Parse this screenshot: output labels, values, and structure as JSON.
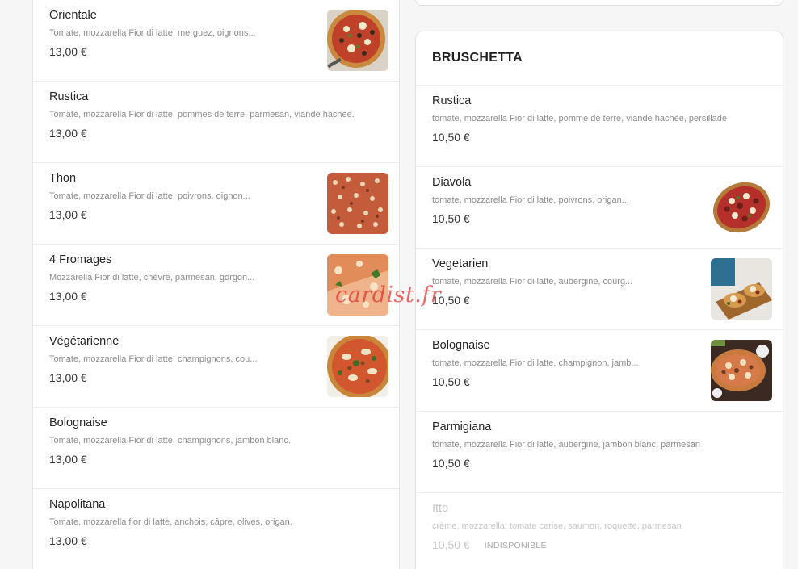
{
  "left_items": [
    {
      "name": "Orientale",
      "desc": "Tomate, mozzarella Fior di latte, merguez, oignons...",
      "price": "13,00 €",
      "image": "pizza-orientale"
    },
    {
      "name": "Rustica",
      "desc": "Tomate, mozzarella Fior di latte, pommes de terre, parmesan, viande hachée.",
      "price": "13,00 €",
      "image": ""
    },
    {
      "name": "Thon",
      "desc": "Tomate, mozzarella Fior di latte, poivrons, oignon...",
      "price": "13,00 €",
      "image": "pizza-thon"
    },
    {
      "name": "4 Fromages",
      "desc": "Mozzarella Fior di latte, chèvre, parmesan, gorgon...",
      "price": "13,00 €",
      "image": "pizza-4-fromages"
    },
    {
      "name": "Végétarienne",
      "desc": "Tomate, mozzarella Fior di latte, champignons, cou...",
      "price": "13,00 €",
      "image": "pizza-vegetarienne"
    },
    {
      "name": "Bolognaise",
      "desc": "Tomate, mozzarella Fior di latte, champignons, jambon blanc.",
      "price": "13,00 €",
      "image": ""
    },
    {
      "name": "Napolitana",
      "desc": "Tomate, mozzarella fior di latte, anchois, câpre, olives, origan.",
      "price": "13,00 €",
      "image": ""
    }
  ],
  "right_section": {
    "title": "BRUSCHETTA",
    "items": [
      {
        "name": "Rustica",
        "desc": "tomate, mozzarella Fior di latte, pomme de terre, viande hachée, persillade",
        "price": "10,50 €",
        "image": ""
      },
      {
        "name": "Diavola",
        "desc": "tomate, mozzarella Fior di latte, poivrons, origan...",
        "price": "10,50 €",
        "image": "bruschetta-diavola"
      },
      {
        "name": "Vegetarien",
        "desc": "tomate, mozzarella Fior di latte, aubergine, courg...",
        "price": "10,50 €",
        "image": "bruschetta-vegetarien"
      },
      {
        "name": "Bolognaise",
        "desc": "tomate, mozzarella Fior di latte, champignon, jamb...",
        "price": "10,50 €",
        "image": "bruschetta-bolognaise"
      },
      {
        "name": "Parmigiana",
        "desc": "tomate, mozzarella Fior di latte, aubergine, jambon blanc, parmesan",
        "price": "10,50 €",
        "image": ""
      },
      {
        "name": "Itto",
        "desc": "crème, mozzarella, tomate cerise, saumon, roquette, parmesan",
        "price": "10,50 €",
        "image": "",
        "badge": "INDISPONIBLE"
      }
    ]
  },
  "watermark": "cardist.fr"
}
